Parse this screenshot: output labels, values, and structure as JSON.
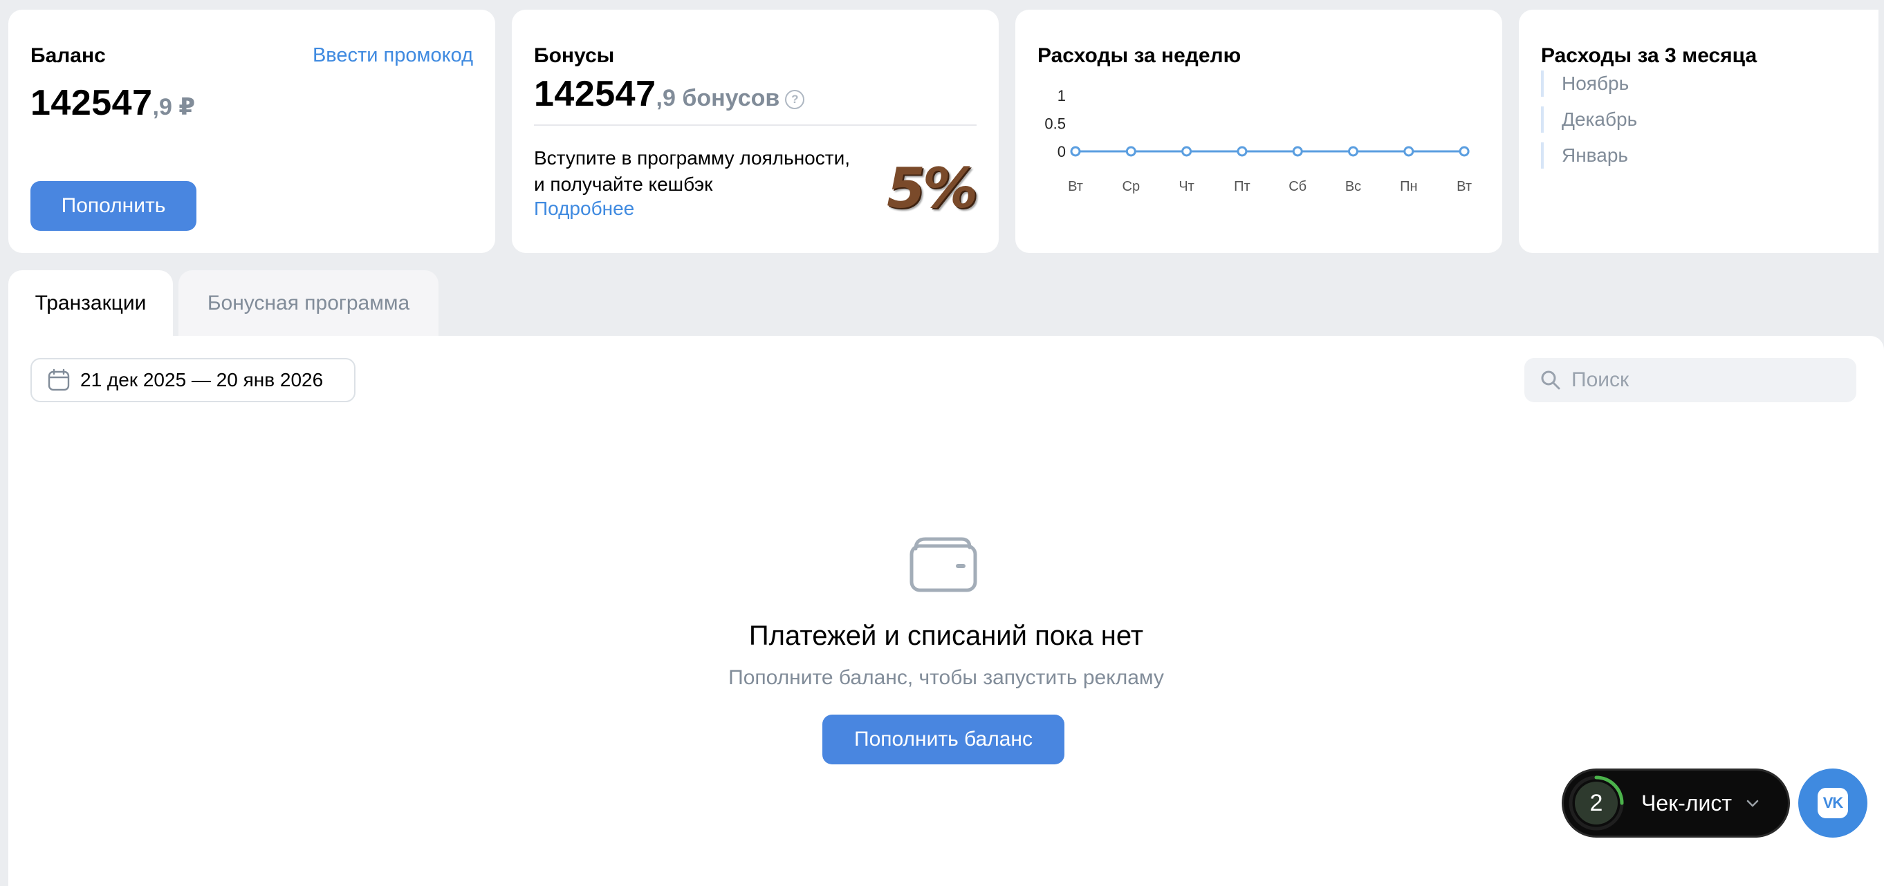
{
  "balance": {
    "title": "Баланс",
    "promo_link": "Ввести промокод",
    "amount_int": "142547",
    "amount_frac": ",9 ₽",
    "topup_button": "Пополнить"
  },
  "bonus": {
    "title": "Бонусы",
    "amount_int": "142547",
    "amount_frac": ",9 бонусов",
    "loyalty_line1": "Вступите в программу лояльности,",
    "loyalty_line2": "и получайте кешбэк",
    "more_link": "Подробнее",
    "cashback_badge": "5%"
  },
  "week_expenses": {
    "title": "Расходы за неделю"
  },
  "chart_data": {
    "type": "line",
    "title": "Расходы за неделю",
    "categories": [
      "Вт",
      "Ср",
      "Чт",
      "Пт",
      "Сб",
      "Вс",
      "Пн",
      "Вт"
    ],
    "values": [
      0,
      0,
      0,
      0,
      0,
      0,
      0,
      0
    ],
    "y_ticks": [
      "1",
      "0.5",
      "0"
    ],
    "ylim": [
      0,
      1
    ],
    "grid": false,
    "line_color": "#5a9ee0"
  },
  "month_expenses": {
    "title": "Расходы за 3 месяца",
    "months": [
      "Ноябрь",
      "Декабрь",
      "Январь"
    ]
  },
  "tabs": [
    {
      "label": "Транзакции",
      "active": true
    },
    {
      "label": "Бонусная программа",
      "active": false
    }
  ],
  "filters": {
    "date_range": "21 дек 2025 — 20 янв 2026",
    "search_placeholder": "Поиск"
  },
  "empty_state": {
    "title": "Платежей и списаний пока нет",
    "subtitle": "Пополните баланс, чтобы запустить рекламу",
    "button": "Пополнить баланс"
  },
  "checklist": {
    "count": "2",
    "label": "Чек-лист",
    "progress": 0.25
  },
  "colors": {
    "accent": "#4986e0",
    "link": "#3f8ae0",
    "background": "#ebedf0"
  }
}
